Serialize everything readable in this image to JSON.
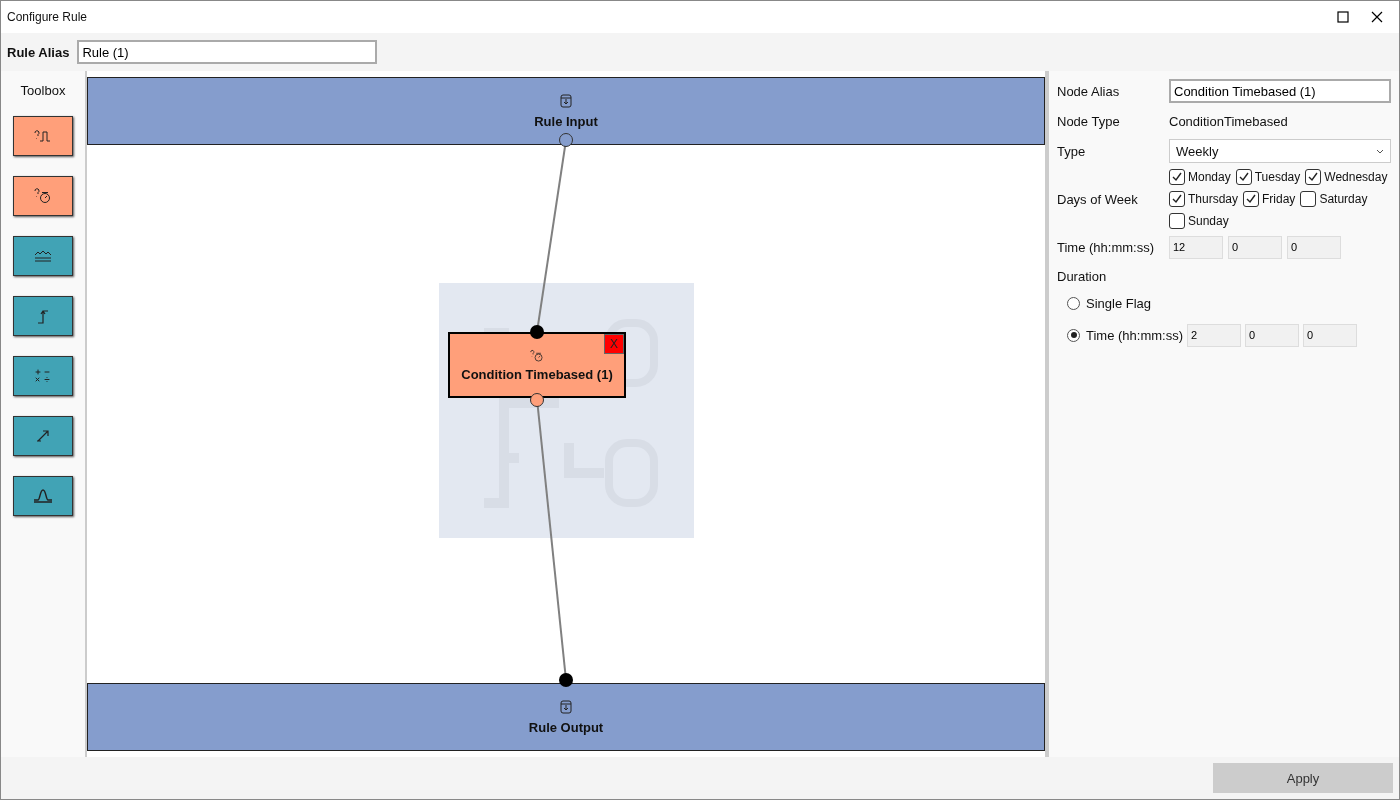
{
  "window": {
    "title": "Configure Rule"
  },
  "rule_alias": {
    "label": "Rule Alias",
    "value": "Rule (1)"
  },
  "toolbox": {
    "title": "Toolbox",
    "items": [
      {
        "kind": "signal",
        "color": "#ff9f7a"
      },
      {
        "kind": "timer",
        "color": "#ff9f7a"
      },
      {
        "kind": "filter",
        "color": "#41a3b5"
      },
      {
        "kind": "step",
        "color": "#41a3b5"
      },
      {
        "kind": "math",
        "color": "#41a3b5"
      },
      {
        "kind": "scale",
        "color": "#41a3b5"
      },
      {
        "kind": "peak",
        "color": "#41a3b5"
      }
    ]
  },
  "canvas": {
    "input_node": {
      "label": "Rule Input"
    },
    "output_node": {
      "label": "Rule Output"
    },
    "nodes": [
      {
        "label": "Condition Timebased (1)",
        "delete": "X",
        "selected": true
      }
    ]
  },
  "properties": {
    "node_alias": {
      "label": "Node Alias",
      "value": "Condition Timebased (1)"
    },
    "node_type": {
      "label": "Node Type",
      "value": "ConditionTimebased"
    },
    "type": {
      "label": "Type",
      "value": "Weekly"
    },
    "days_of_week": {
      "label": "Days of Week",
      "days": [
        {
          "label": "Monday",
          "checked": true
        },
        {
          "label": "Tuesday",
          "checked": true
        },
        {
          "label": "Wednesday",
          "checked": true
        },
        {
          "label": "Thursday",
          "checked": true
        },
        {
          "label": "Friday",
          "checked": true
        },
        {
          "label": "Saturday",
          "checked": false
        },
        {
          "label": "Sunday",
          "checked": false
        }
      ]
    },
    "time": {
      "label": "Time (hh:mm:ss)",
      "values": [
        "12",
        "0",
        "0"
      ]
    },
    "duration": {
      "label": "Duration",
      "options": [
        {
          "label": "Single Flag",
          "selected": false
        },
        {
          "label": "Time (hh:mm:ss)",
          "selected": true,
          "values": [
            "2",
            "0",
            "0"
          ]
        }
      ]
    }
  },
  "footer": {
    "apply": "Apply"
  }
}
